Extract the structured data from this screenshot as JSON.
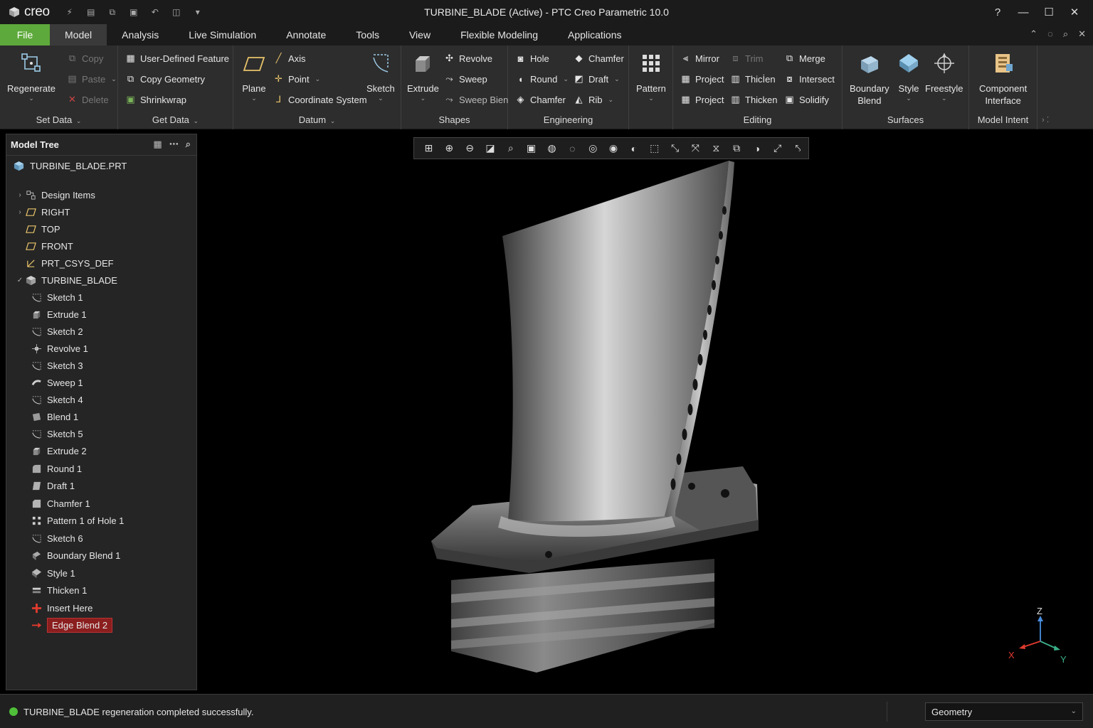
{
  "app": {
    "logo_text": "creo",
    "window_title": "TURBINE_BLADE (Active) - PTC Creo Parametric 10.0",
    "help_symbol": "?"
  },
  "tabs": [
    {
      "label": "File"
    },
    {
      "label": "Model"
    },
    {
      "label": "Analysis"
    },
    {
      "label": "Live Simulation"
    },
    {
      "label": "Annotate"
    },
    {
      "label": "Tools"
    },
    {
      "label": "View"
    },
    {
      "label": "Flexible Modeling"
    },
    {
      "label": "Applications"
    }
  ],
  "ribbon": {
    "operations": {
      "regenerate": "Regenerate",
      "copy": "Copy",
      "paste": "Paste",
      "delete": "Delete",
      "group": "Set Data"
    },
    "get_data": {
      "udf": "User-Defined Feature",
      "copy_geometry": "Copy Geometry",
      "shrinkwrap": "Shrinkwrap",
      "group": "Get Data"
    },
    "datum": {
      "plane": "Plane",
      "axis": "Axis",
      "point": "Point",
      "csys": "Coordinate System",
      "sketch": "Sketch",
      "group": "Datum"
    },
    "shapes": {
      "extrude": "Extrude",
      "revolve": "Revolve",
      "sweep": "Sweep",
      "sweep_blend": "Sweep Bien",
      "group": "Shapes"
    },
    "engineering": {
      "hole": "Hole",
      "round": "Round",
      "chamfer": "Chamfer",
      "chamfer2": "Chamfer",
      "draft": "Draft",
      "rib": "Rib",
      "group": "Engineering"
    },
    "pattern": {
      "label": "Pattern"
    },
    "editing": {
      "mirror": "Mirror",
      "trim": "Trim",
      "merge": "Merge",
      "project": "Project",
      "thicken_a": "Thicİen",
      "intersect": "Intersect",
      "project2": "Project",
      "thicken": "Thicken",
      "solidify": "Solidify",
      "group": "Editing"
    },
    "surfaces": {
      "boundary": "Boundary",
      "blend": "Blend",
      "style": "Style",
      "freestyle": "Freestyle",
      "group": "Surfaces"
    },
    "model_intent": {
      "component": "Component",
      "interface": "Interface",
      "group": "Model Intent"
    }
  },
  "model_tree": {
    "title": "Model Tree",
    "root": "TURBINE_BLADE.PRT",
    "items": [
      {
        "label": "Design Items",
        "icon": "design-items-icon",
        "expander": "›"
      },
      {
        "label": "RIGHT",
        "icon": "datum-plane-icon",
        "expander": "›"
      },
      {
        "label": "TOP",
        "icon": "datum-plane-icon",
        "expander": ""
      },
      {
        "label": "FRONT",
        "icon": "datum-plane-icon",
        "expander": ""
      },
      {
        "label": "PRT_CSYS_DEF",
        "icon": "csys-icon",
        "expander": ""
      },
      {
        "label": "TURBINE_BLADE",
        "icon": "part-icon",
        "expander": "✓"
      },
      {
        "label": "Sketch 1",
        "icon": "sketch-icon",
        "expander": ""
      },
      {
        "label": "Extrude 1",
        "icon": "extrude-icon",
        "expander": ""
      },
      {
        "label": "Sketch 2",
        "icon": "sketch-icon",
        "expander": ""
      },
      {
        "label": "Revolve 1",
        "icon": "revolve-icon",
        "expander": ""
      },
      {
        "label": "Sketch 3",
        "icon": "sketch-icon",
        "expander": ""
      },
      {
        "label": "Sweep 1",
        "icon": "sweep-icon",
        "expander": ""
      },
      {
        "label": "Sketch 4",
        "icon": "sketch-icon",
        "expander": ""
      },
      {
        "label": "Blend 1",
        "icon": "blend-icon",
        "expander": ""
      },
      {
        "label": "Sketch 5",
        "icon": "sketch-icon",
        "expander": ""
      },
      {
        "label": "Extrude 2",
        "icon": "extrude-icon",
        "expander": ""
      },
      {
        "label": "Round 1",
        "icon": "round-icon",
        "expander": ""
      },
      {
        "label": "Draft 1",
        "icon": "draft-icon",
        "expander": ""
      },
      {
        "label": "Chamfer 1",
        "icon": "chamfer-icon",
        "expander": ""
      },
      {
        "label": "Pattern 1 of Hole 1",
        "icon": "pattern-icon",
        "expander": ""
      },
      {
        "label": "Sketch 6",
        "icon": "sketch-icon",
        "expander": ""
      },
      {
        "label": "Boundary Blend 1",
        "icon": "boundary-blend-icon",
        "expander": ""
      },
      {
        "label": "Style 1",
        "icon": "style-icon",
        "expander": ""
      },
      {
        "label": "Thicken 1",
        "icon": "thicken-icon",
        "expander": ""
      },
      {
        "label": "Insert Here",
        "icon": "insert-here-icon",
        "expander": ""
      },
      {
        "label": "Edge Blend 2",
        "icon": "insert-arrow-icon",
        "expander": "",
        "selected": true
      }
    ]
  },
  "triad": {
    "z": "Z",
    "x": "X",
    "y": "Y"
  },
  "status": {
    "message": "TURBINE_BLADE regeneration completed successfully.",
    "filter": "Geometry",
    "color": "#4fbf3a"
  },
  "colors": {
    "file_tab": "#5ea93b",
    "selection": "#8b1e1e",
    "accent_red": "#d9342b"
  }
}
